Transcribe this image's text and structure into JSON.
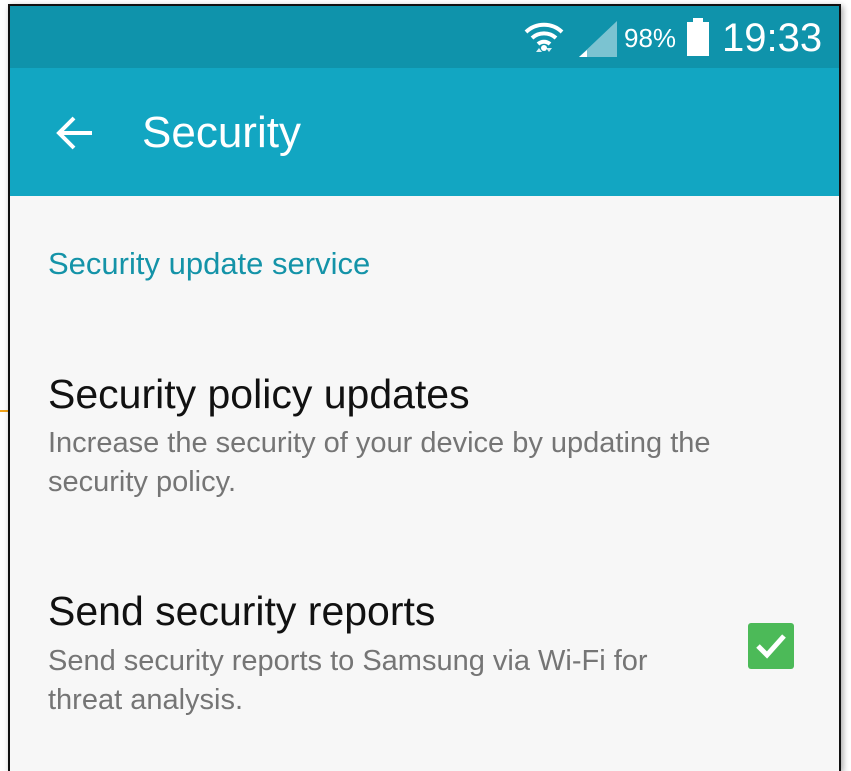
{
  "status_bar": {
    "wifi_icon": "wifi-icon",
    "signal_icon": "cell-signal-icon",
    "battery_percent": "98%",
    "battery_icon": "battery-icon",
    "time": "19:33",
    "background_color": "#0f93ab"
  },
  "app_bar": {
    "back_icon": "back-arrow-icon",
    "title": "Security",
    "background_color": "#12a6c2"
  },
  "section": {
    "header": "Security update service",
    "accent_color": "#1493a8"
  },
  "items": [
    {
      "title": "Security policy updates",
      "summary": "Increase the security of your device by updating the security policy."
    },
    {
      "title": "Send security reports",
      "summary": "Send security reports to Samsung via Wi-Fi for threat analysis.",
      "checked": true,
      "checkbox_color": "#4cba58"
    }
  ]
}
